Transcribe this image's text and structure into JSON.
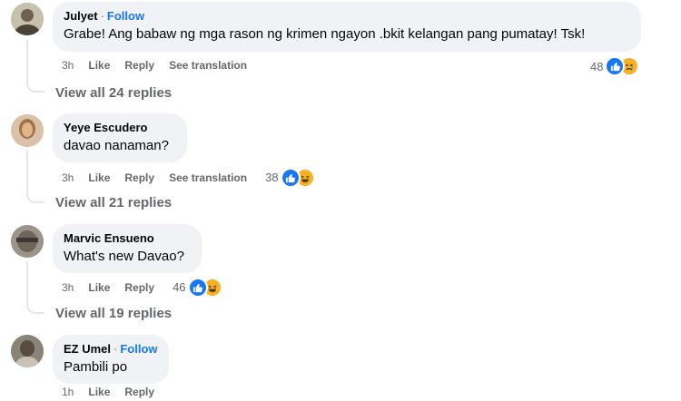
{
  "comments": [
    {
      "author": "Julyet",
      "follow_label": "Follow",
      "text": "Grabe! Ang babaw ng mga rason ng krimen ngayon .bkit kelangan pang pumatay! Tsk!",
      "time": "3h",
      "like_label": "Like",
      "reply_label": "Reply",
      "translation_label": "See translation",
      "reaction_count": "48",
      "reactions": [
        "like-icon",
        "sad-icon"
      ],
      "view_replies": "View all 24 replies"
    },
    {
      "author": "Yeye Escudero",
      "text": "davao nanaman?",
      "time": "3h",
      "like_label": "Like",
      "reply_label": "Reply",
      "translation_label": "See translation",
      "reaction_count": "38",
      "reactions": [
        "like-icon",
        "haha-icon"
      ],
      "view_replies": "View all 21 replies"
    },
    {
      "author": "Marvic Ensueno",
      "text": "What's new Davao?",
      "time": "3h",
      "like_label": "Like",
      "reply_label": "Reply",
      "reaction_count": "46",
      "reactions": [
        "like-icon",
        "haha-icon"
      ],
      "view_replies": "View all 19 replies"
    },
    {
      "author": "EZ Umel",
      "follow_label": "Follow",
      "text": "Pambili po",
      "time": "1h",
      "like_label": "Like",
      "reply_label": "Reply"
    }
  ],
  "colors": {
    "accent": "#1877f2",
    "bubble": "#f0f2f5",
    "secondary_text": "#65676b",
    "reaction_yellow": "#f7b125"
  }
}
